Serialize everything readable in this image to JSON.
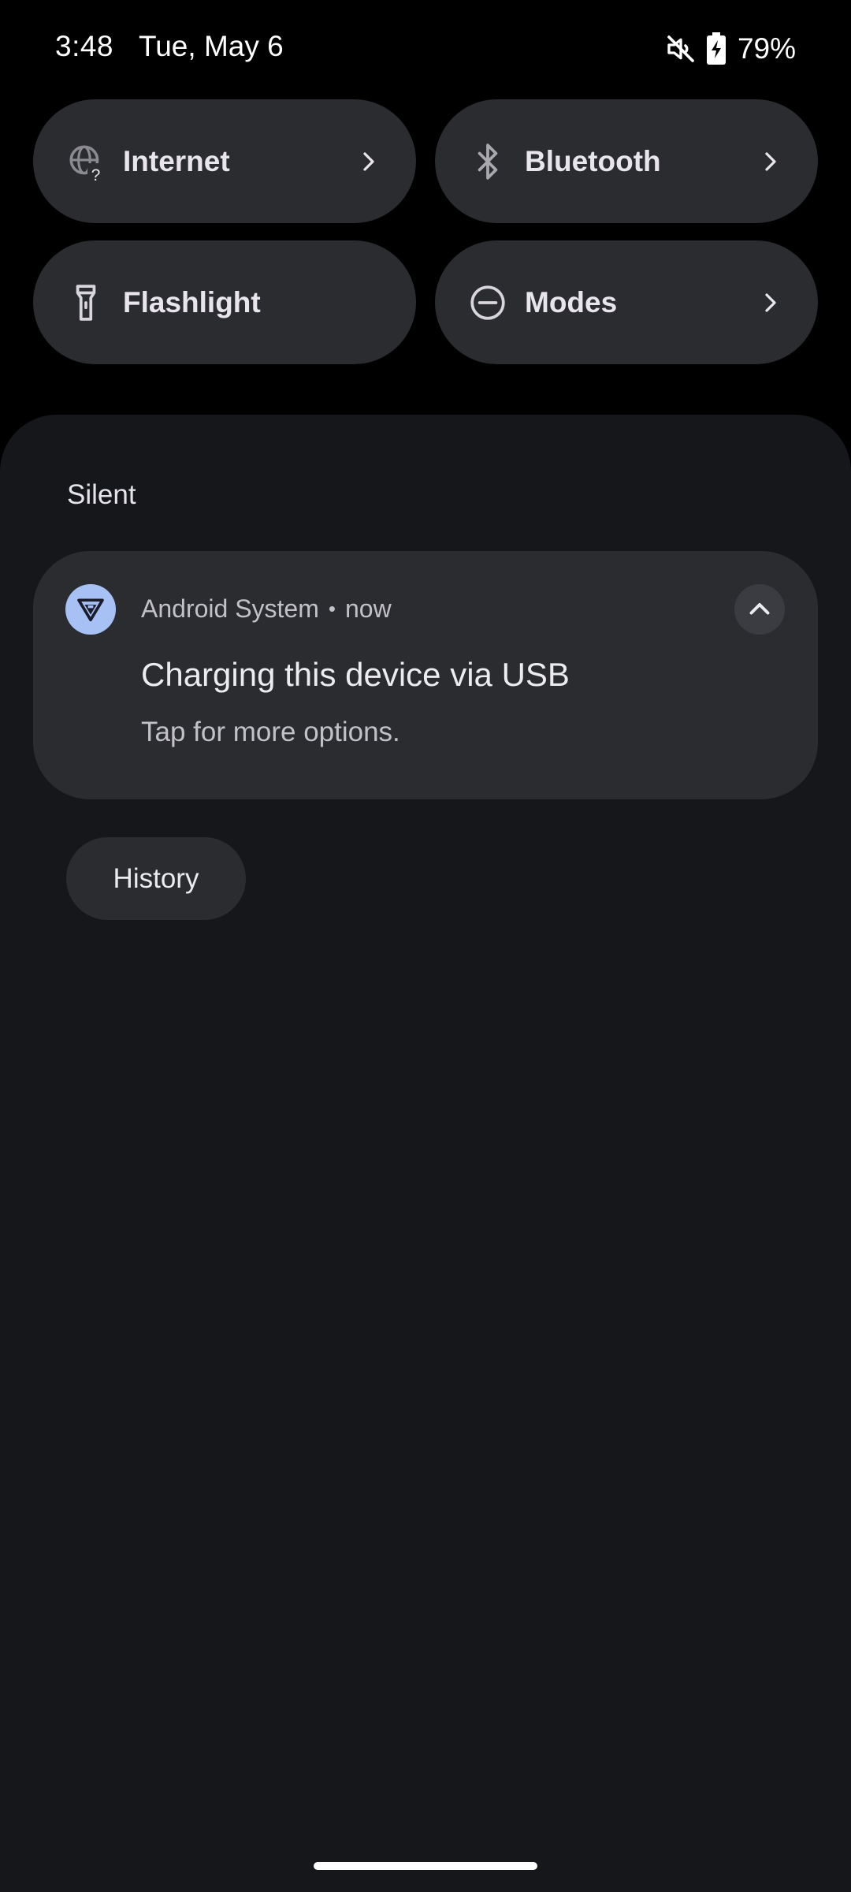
{
  "status_bar": {
    "time": "3:48",
    "date": "Tue, May 6",
    "battery_percent": "79%",
    "battery_level": 0.79,
    "icons": [
      "mute-icon",
      "battery-charging-icon"
    ]
  },
  "quick_settings": {
    "tiles": [
      {
        "label": "Internet",
        "icon": "internet-unknown-icon",
        "has_chevron": true
      },
      {
        "label": "Bluetooth",
        "icon": "bluetooth-icon",
        "has_chevron": true
      },
      {
        "label": "Flashlight",
        "icon": "flashlight-icon",
        "has_chevron": false
      },
      {
        "label": "Modes",
        "icon": "do-not-disturb-icon",
        "has_chevron": true
      }
    ]
  },
  "notifications": {
    "section_title": "Silent",
    "items": [
      {
        "app_name": "Android System",
        "separator": "•",
        "time": "now",
        "title": "Charging this device via USB",
        "text": "Tap for more options.",
        "icon": "usb-icon",
        "icon_bg": "#a8c1f5"
      }
    ],
    "history_label": "History"
  },
  "colors": {
    "background": "#000000",
    "shade": "#16171b",
    "tile": "#2b2c30",
    "accent": "#a8c1f5"
  }
}
